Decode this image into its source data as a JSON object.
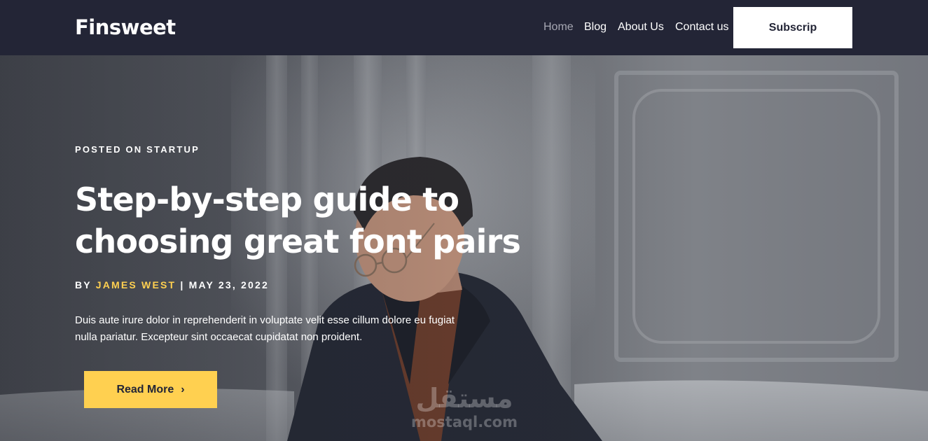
{
  "header": {
    "logo": "Finsweet",
    "nav": [
      {
        "label": "Home",
        "active": true
      },
      {
        "label": "Blog",
        "active": false
      },
      {
        "label": "About Us",
        "active": false
      },
      {
        "label": "Contact us",
        "active": false
      }
    ],
    "subscribe_label": "Subscrip"
  },
  "hero": {
    "kicker": "POSTED ON STARTUP",
    "headline": "Step-by-step guide to choosing great font pairs",
    "byline_prefix": "BY",
    "author": "JAMES WEST",
    "separator": "|",
    "date": "MAY 23, 2022",
    "excerpt": "Duis aute irure dolor in reprehenderit in voluptate velit esse cillum dolore eu fugiat nulla pariatur. Excepteur sint occaecat cupidatat non proident.",
    "cta_label": "Read More",
    "cta_icon": "chevron-right-icon"
  },
  "watermark": {
    "arabic": "مستقل",
    "latin": "mostaql.com"
  },
  "colors": {
    "navbar": "#232536",
    "accent": "#FFD050",
    "text": "#FFFFFF",
    "nav_active": "#A7A8B3"
  }
}
